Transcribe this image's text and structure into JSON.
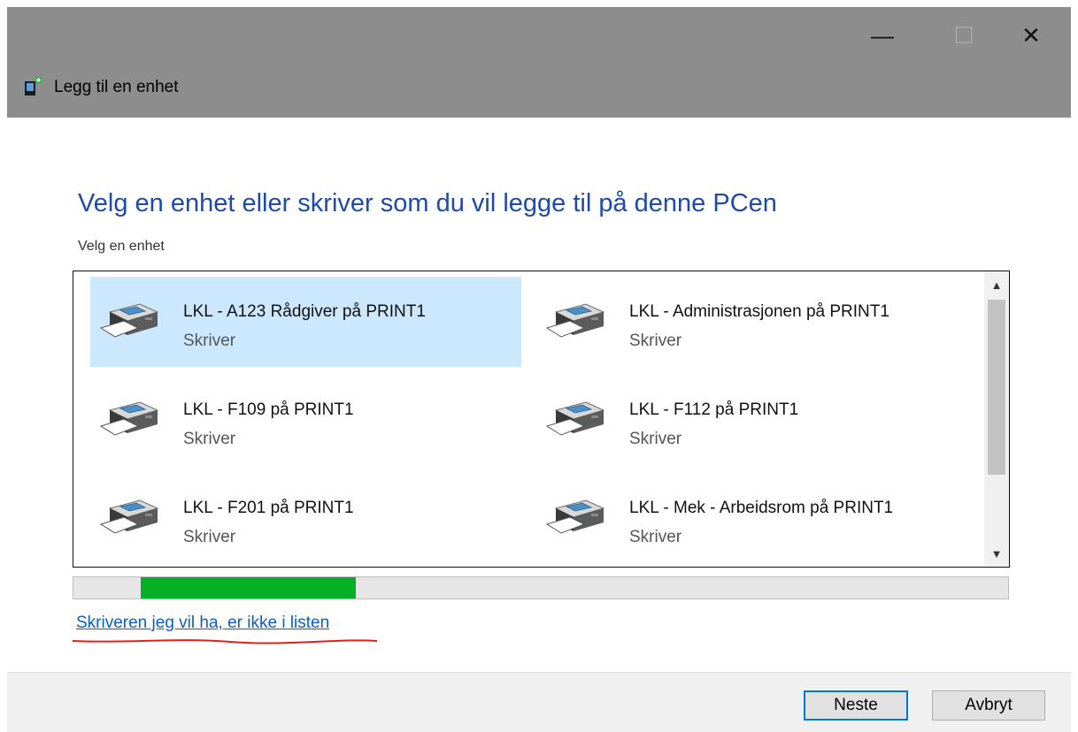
{
  "window": {
    "title": "Legg til en enhet",
    "controls": {
      "minimize": "—",
      "maximize": "☐",
      "close": "✕"
    },
    "icon": "device-add-icon"
  },
  "main": {
    "heading": "Velg en enhet eller skriver som du vil legge til på denne PCen",
    "subheading": "Velg en enhet"
  },
  "devices": [
    {
      "name": "LKL - A123 Rådgiver på PRINT1",
      "type": "Skriver",
      "selected": true,
      "icon": "printer-icon"
    },
    {
      "name": "LKL - Administrasjonen på PRINT1",
      "type": "Skriver",
      "selected": false,
      "icon": "printer-icon"
    },
    {
      "name": "LKL - F109 på PRINT1",
      "type": "Skriver",
      "selected": false,
      "icon": "printer-icon"
    },
    {
      "name": "LKL - F112 på PRINT1",
      "type": "Skriver",
      "selected": false,
      "icon": "printer-icon"
    },
    {
      "name": "LKL - F201 på PRINT1",
      "type": "Skriver",
      "selected": false,
      "icon": "printer-icon"
    },
    {
      "name": "LKL - Mek - Arbeidsrom på PRINT1",
      "type": "Skriver",
      "selected": false,
      "icon": "printer-icon"
    }
  ],
  "progress": {
    "start": 0.072,
    "end": 0.302,
    "color": "#06b025"
  },
  "link_text": "Skriveren jeg vil ha, er ikke i listen",
  "buttons": {
    "next": "Neste",
    "cancel": "Avbryt"
  },
  "colors": {
    "heading": "#1f4aa8",
    "link": "#0a5fc4",
    "selection": "#cce8ff",
    "titlebar": "#8d8d8d"
  }
}
